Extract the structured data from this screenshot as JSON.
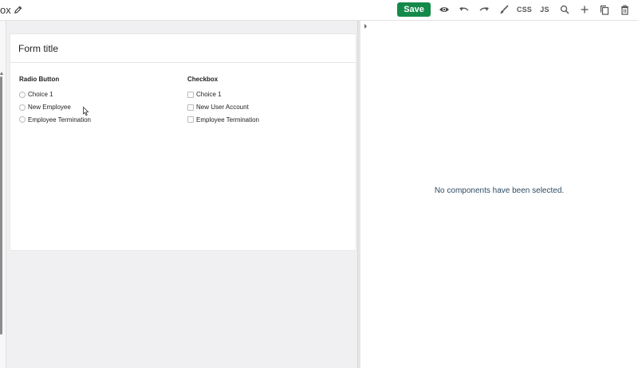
{
  "header": {
    "title": "ox",
    "save_label": "Save",
    "css_label": "CSS",
    "js_label": "JS"
  },
  "icons": [
    "edit-icon",
    "preview-eye-icon",
    "undo-icon",
    "redo-icon",
    "brush-icon",
    "search-icon",
    "plus-icon",
    "copy-icon",
    "trash-icon"
  ],
  "colors": {
    "save_button": "#148a4a",
    "empty_message": "#2e4b63"
  },
  "form": {
    "title": "Form title",
    "radio": {
      "heading": "Radio Button",
      "options": [
        "Choice 1",
        "New Employee",
        "Employee Termination"
      ]
    },
    "checkbox": {
      "heading": "Checkbox",
      "options": [
        "Choice 1",
        "New User Account",
        "Employee Termination"
      ]
    }
  },
  "properties_panel": {
    "empty_message": "No components have been selected."
  }
}
